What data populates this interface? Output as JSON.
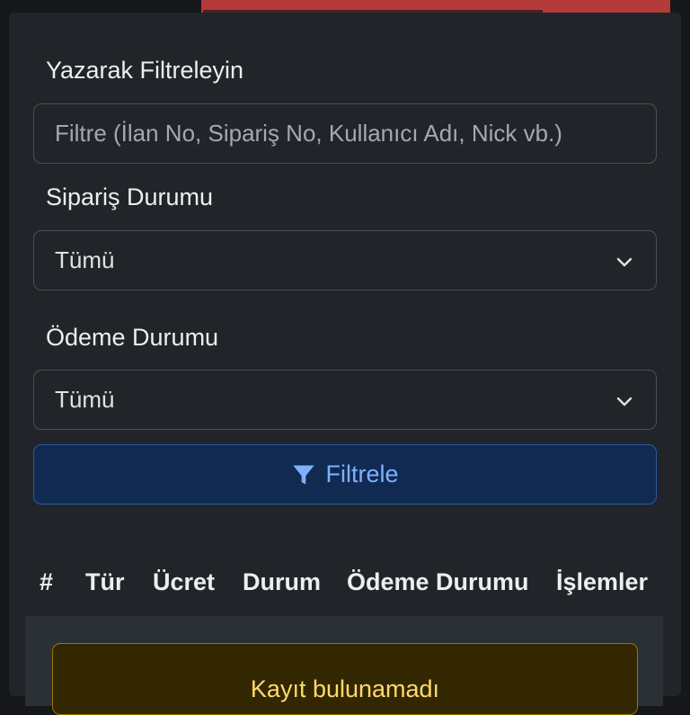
{
  "filters": {
    "author_label": "Yazarak Filtreleyin",
    "author_placeholder": "Filtre (İlan No, Sipariş No, Kullanıcı Adı, Nick vb.)",
    "order_status_label": "Sipariş Durumu",
    "order_status_value": "Tümü",
    "payment_status_label": "Ödeme Durumu",
    "payment_status_value": "Tümü",
    "filter_button_label": "Filtrele"
  },
  "table": {
    "headers": [
      "#",
      "Tür",
      "Ücret",
      "Durum",
      "Ödeme Durumu",
      "İşlemler"
    ],
    "empty_message": "Kayıt bulunamadı"
  },
  "colors": {
    "background": "#212529",
    "primary_button_text": "#7fb0ff",
    "warning_text": "#ffda6a",
    "top_bar": "#b53a3a"
  },
  "icons": {
    "filter": "filter-funnel-icon",
    "select_arrow": "chevron-down-icon"
  }
}
